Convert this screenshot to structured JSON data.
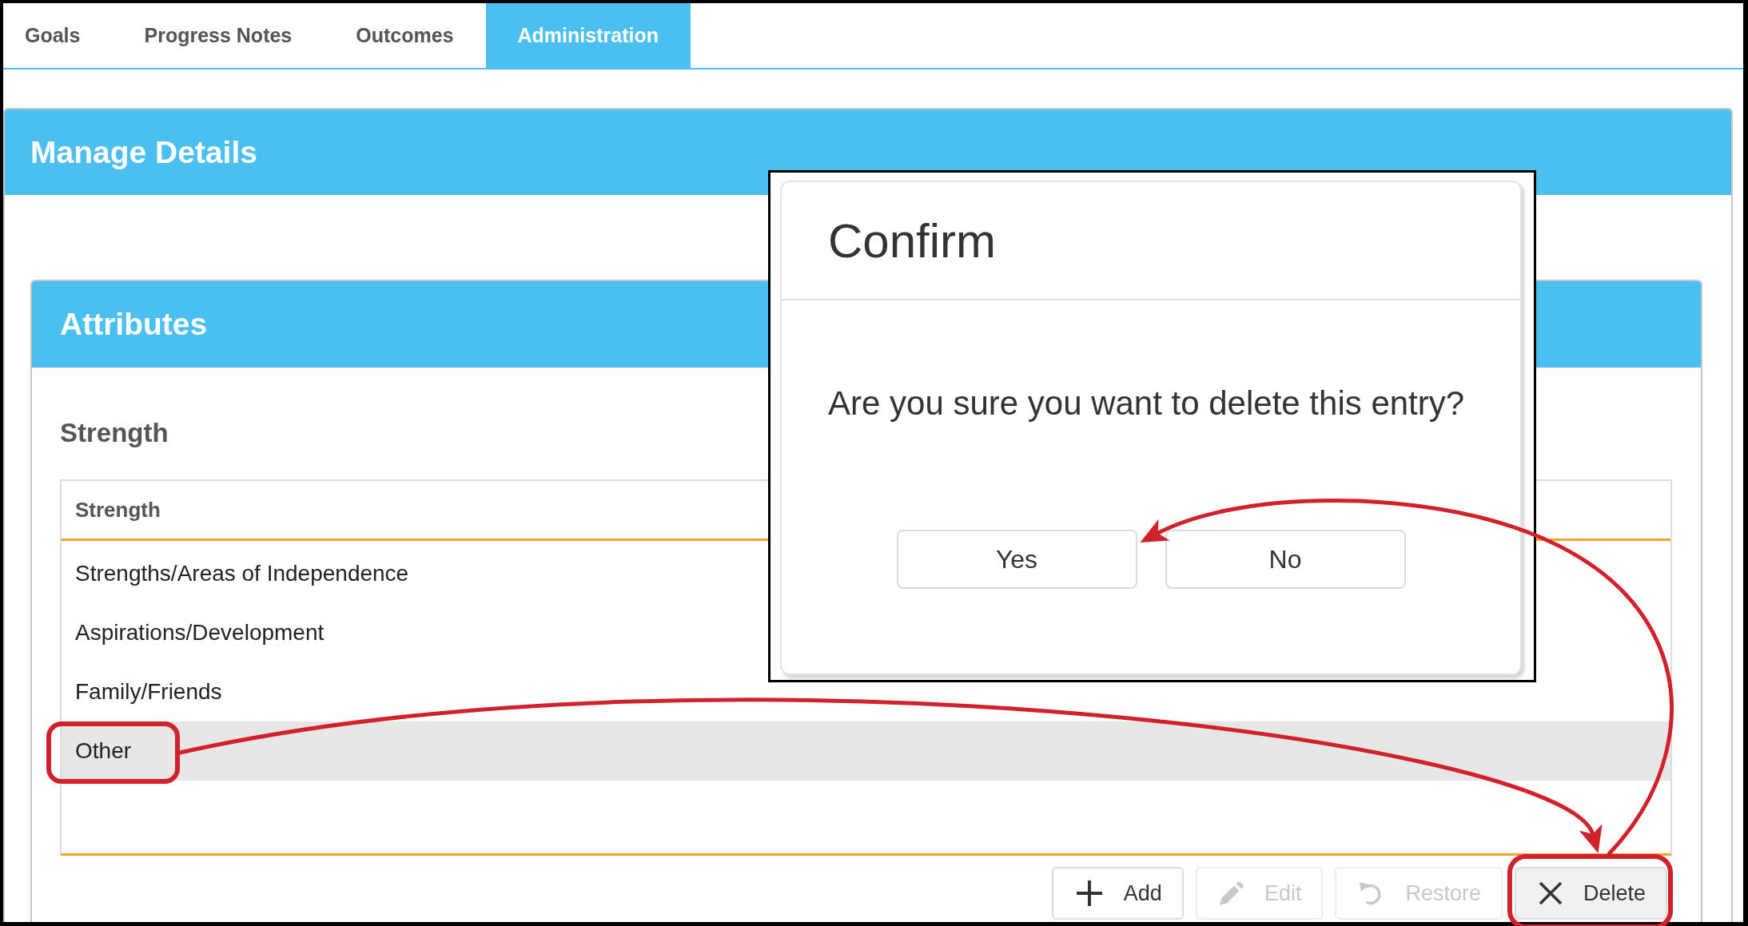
{
  "tabs": [
    {
      "label": "Goals",
      "selected": false
    },
    {
      "label": "Progress Notes",
      "selected": false
    },
    {
      "label": "Outcomes",
      "selected": false
    },
    {
      "label": "Administration",
      "selected": true
    }
  ],
  "panel": {
    "title": "Manage Details",
    "section": {
      "title": "Attributes",
      "heading": "Strength",
      "table": {
        "columns": [
          "Strength"
        ],
        "rows": [
          {
            "cells": [
              "Strengths/Areas of Independence"
            ],
            "selected": false,
            "highlighted": false
          },
          {
            "cells": [
              "Aspirations/Development"
            ],
            "selected": false,
            "highlighted": false
          },
          {
            "cells": [
              "Family/Friends"
            ],
            "selected": false,
            "highlighted": false
          },
          {
            "cells": [
              "Other"
            ],
            "selected": true,
            "highlighted": true
          }
        ]
      },
      "buttons": [
        {
          "kind": "add",
          "label": "Add",
          "disabled": false,
          "pressed": false,
          "highlighted": false
        },
        {
          "kind": "edit",
          "label": "Edit",
          "disabled": true,
          "pressed": false,
          "highlighted": false
        },
        {
          "kind": "restore",
          "label": "Restore",
          "disabled": true,
          "pressed": false,
          "highlighted": false
        },
        {
          "kind": "delete",
          "label": "Delete",
          "disabled": false,
          "pressed": true,
          "highlighted": true
        }
      ]
    }
  },
  "dialog": {
    "title": "Confirm",
    "message": "Are you sure you want to delete this entry?",
    "buttons": [
      {
        "label": "Yes"
      },
      {
        "label": "No"
      }
    ]
  }
}
